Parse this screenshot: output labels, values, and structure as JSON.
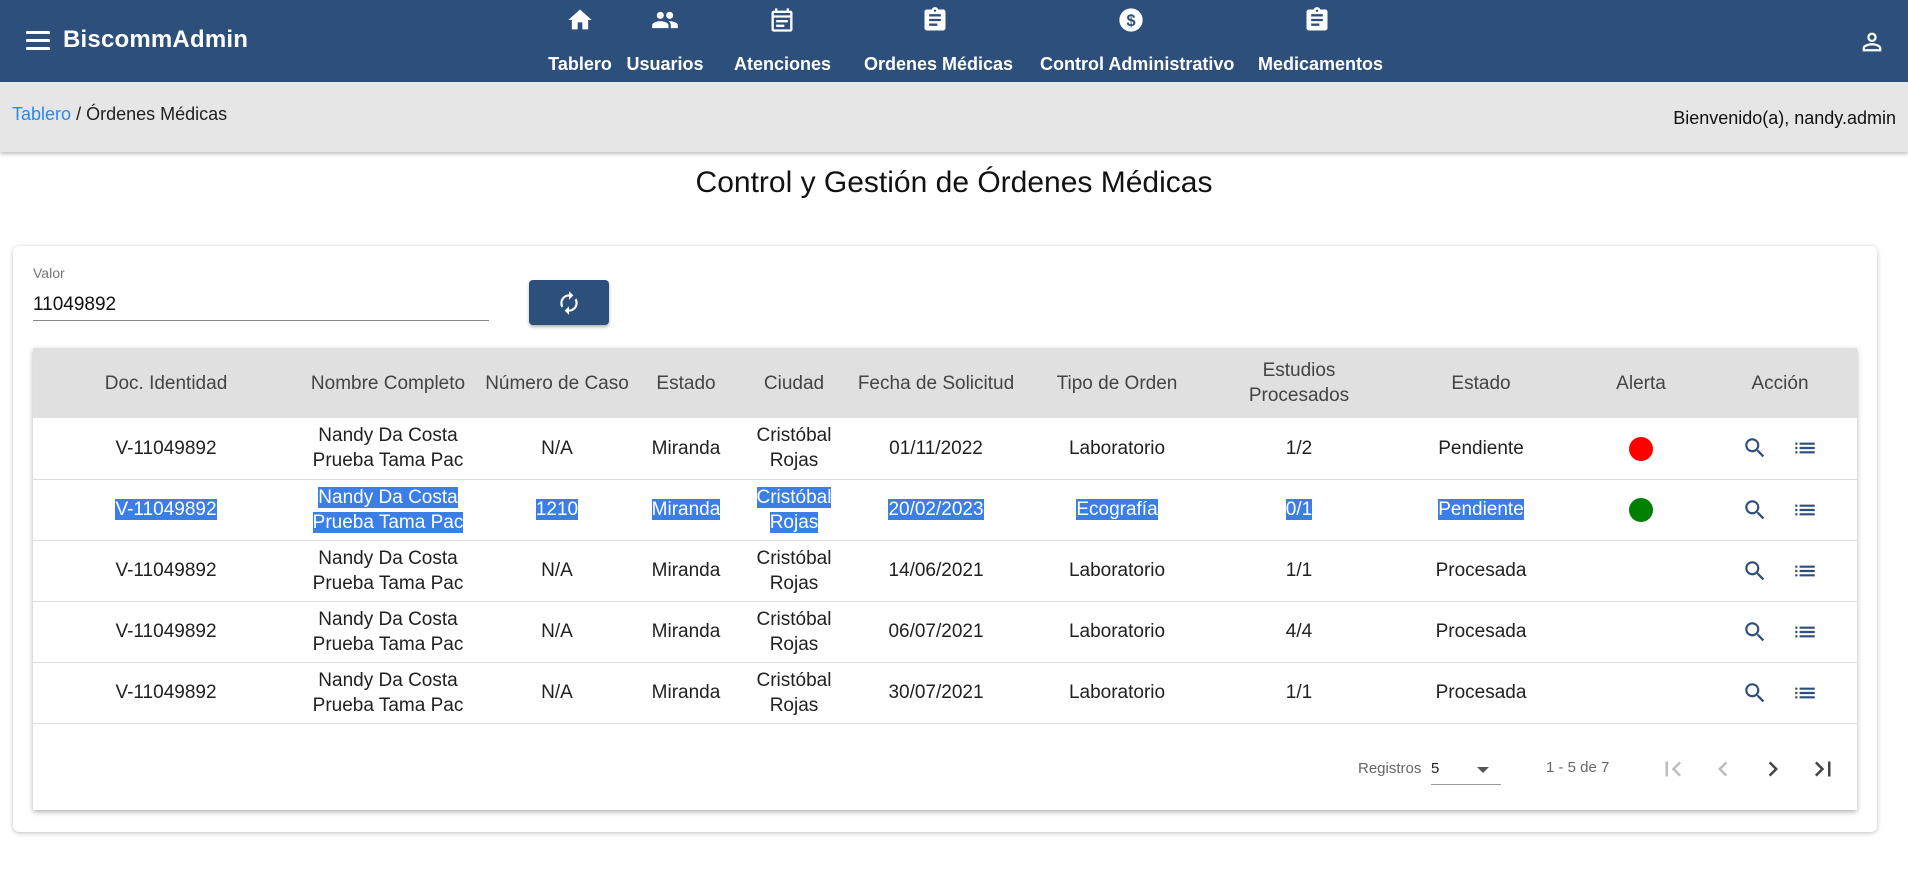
{
  "app": {
    "title": "BiscommAdmin"
  },
  "nav": [
    {
      "label": "Tablero",
      "icon": "home-icon"
    },
    {
      "label": "Usuarios",
      "icon": "users-icon"
    },
    {
      "label": "Atenciones",
      "icon": "calendar-icon"
    },
    {
      "label": "Ordenes Médicas",
      "icon": "clipboard-icon"
    },
    {
      "label": "Control Administrativo",
      "icon": "dollar-icon"
    },
    {
      "label": "Medicamentos",
      "icon": "clipboard-icon"
    }
  ],
  "breadcrumb": {
    "root": "Tablero",
    "separator": "/",
    "current": "Órdenes Médicas"
  },
  "welcome": "Bienvenido(a), nandy.admin",
  "page_title": "Control y Gestión de Órdenes Médicas",
  "search": {
    "label": "Valor",
    "value": "11049892"
  },
  "table": {
    "headers": [
      "Doc. Identidad",
      "Nombre Completo",
      "Número de Caso",
      "Estado",
      "Ciudad",
      "Fecha de Solicitud",
      "Tipo de Orden",
      "Estudios Procesados",
      "Estado",
      "Alerta",
      "Acción"
    ],
    "rows": [
      {
        "doc": "V-11049892",
        "name": "Nandy Da Costa Prueba Tama Pac",
        "case": "N/A",
        "state": "Miranda",
        "city": "Cristóbal Rojas",
        "date": "01/11/2022",
        "type": "Laboratorio",
        "studies": "1/2",
        "status": "Pendiente",
        "alert": "red"
      },
      {
        "doc": "V-11049892",
        "name": "Nandy Da Costa Prueba Tama Pac",
        "case": "1210",
        "state": "Miranda",
        "city": "Cristóbal Rojas",
        "date": "20/02/2023",
        "type": "Ecografía",
        "studies": "0/1",
        "status": "Pendiente",
        "alert": "green"
      },
      {
        "doc": "V-11049892",
        "name": "Nandy Da Costa Prueba Tama Pac",
        "case": "N/A",
        "state": "Miranda",
        "city": "Cristóbal Rojas",
        "date": "14/06/2021",
        "type": "Laboratorio",
        "studies": "1/1",
        "status": "Procesada",
        "alert": ""
      },
      {
        "doc": "V-11049892",
        "name": "Nandy Da Costa Prueba Tama Pac",
        "case": "N/A",
        "state": "Miranda",
        "city": "Cristóbal Rojas",
        "date": "06/07/2021",
        "type": "Laboratorio",
        "studies": "4/4",
        "status": "Procesada",
        "alert": ""
      },
      {
        "doc": "V-11049892",
        "name": "Nandy Da Costa Prueba Tama Pac",
        "case": "N/A",
        "state": "Miranda",
        "city": "Cristóbal Rojas",
        "date": "30/07/2021",
        "type": "Laboratorio",
        "studies": "1/1",
        "status": "Procesada",
        "alert": ""
      }
    ]
  },
  "paginator": {
    "label": "Registros",
    "page_size": "5",
    "range": "1 - 5 de 7"
  },
  "colors": {
    "primary": "#2c4f7c",
    "link": "#2a8aea",
    "alert_red": "#ff0000",
    "alert_green": "#008000",
    "selection": "#3a7ee6"
  }
}
